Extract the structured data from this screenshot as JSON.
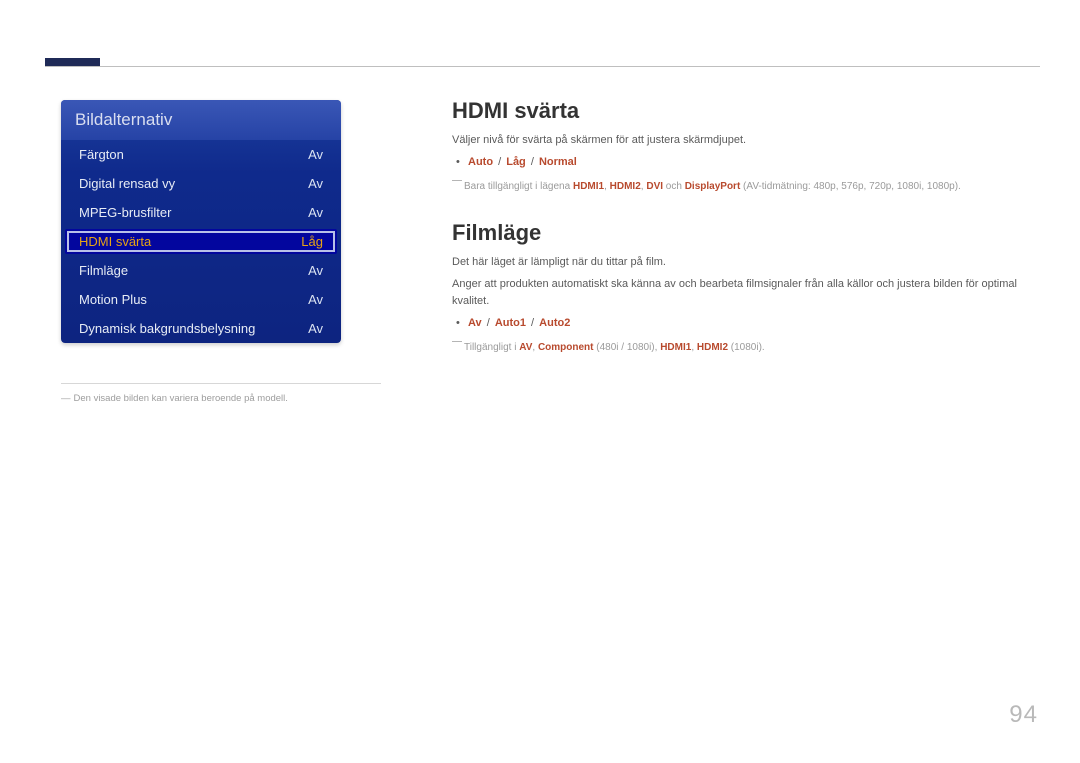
{
  "menu": {
    "title": "Bildalternativ",
    "items": [
      {
        "label": "Färgton",
        "value": "Av",
        "selected": false
      },
      {
        "label": "Digital rensad vy",
        "value": "Av",
        "selected": false
      },
      {
        "label": "MPEG-brusfilter",
        "value": "Av",
        "selected": false
      },
      {
        "label": "HDMI svärta",
        "value": "Låg",
        "selected": true
      },
      {
        "label": "Filmläge",
        "value": "Av",
        "selected": false
      },
      {
        "label": "Motion Plus",
        "value": "Av",
        "selected": false
      },
      {
        "label": "Dynamisk bakgrundsbelysning",
        "value": "Av",
        "selected": false
      }
    ]
  },
  "caption": "Den visade bilden kan variera beroende på modell.",
  "sections": {
    "hdmi": {
      "title": "HDMI svärta",
      "desc": "Väljer nivå för svärta på skärmen för att justera skärmdjupet.",
      "options": [
        "Auto",
        "Låg",
        "Normal"
      ],
      "note_pre": "Bara tillgängligt i lägena ",
      "note_bold": [
        "HDMI1",
        "HDMI2",
        "DVI"
      ],
      "note_mid": " och ",
      "note_bold2": "DisplayPort",
      "note_tail": " (AV-tidmätning: 480p, 576p, 720p, 1080i, 1080p)."
    },
    "film": {
      "title": "Filmläge",
      "desc1": "Det här läget är lämpligt när du tittar på film.",
      "desc2": "Anger att produkten automatiskt ska känna av och bearbeta filmsignaler från alla källor och justera bilden för optimal kvalitet.",
      "options": [
        "Av",
        "Auto1",
        "Auto2"
      ],
      "note_pre": "Tillgängligt i ",
      "note_av": "AV",
      "note_comp": "Component",
      "note_comp_tail": " (480i / 1080i), ",
      "note_h1": "HDMI1",
      "note_h2": "HDMI2",
      "note_h_tail": " (1080i)."
    }
  },
  "page": "94"
}
